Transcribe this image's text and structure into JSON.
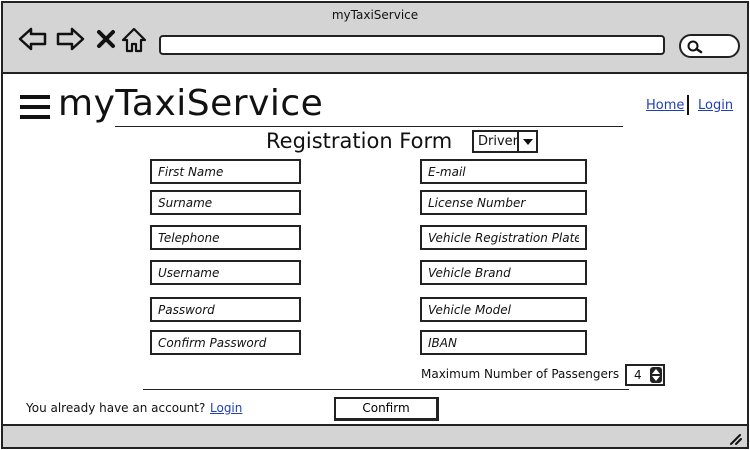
{
  "browser": {
    "title": "myTaxiService",
    "address": ""
  },
  "header": {
    "brand": "myTaxiService",
    "links": {
      "home": "Home",
      "login": "Login"
    }
  },
  "form": {
    "title": "Registration Form",
    "role": "Driver",
    "left_fields": {
      "first_name": "First Name",
      "surname": "Surname",
      "telephone": "Telephone",
      "username": "Username",
      "password": "Password",
      "confirm_password": "Confirm Password"
    },
    "right_fields": {
      "email": "E-mail",
      "license_number": "License Number",
      "vehicle_plate": "Vehicle Registration Plate",
      "vehicle_brand": "Vehicle Brand",
      "vehicle_model": "Vehicle Model",
      "iban": "IBAN"
    },
    "passengers_label": "Maximum Number of Passengers",
    "passengers_value": "4",
    "account_prompt": "You already have an account?",
    "account_link": "Login",
    "confirm": "Confirm"
  }
}
